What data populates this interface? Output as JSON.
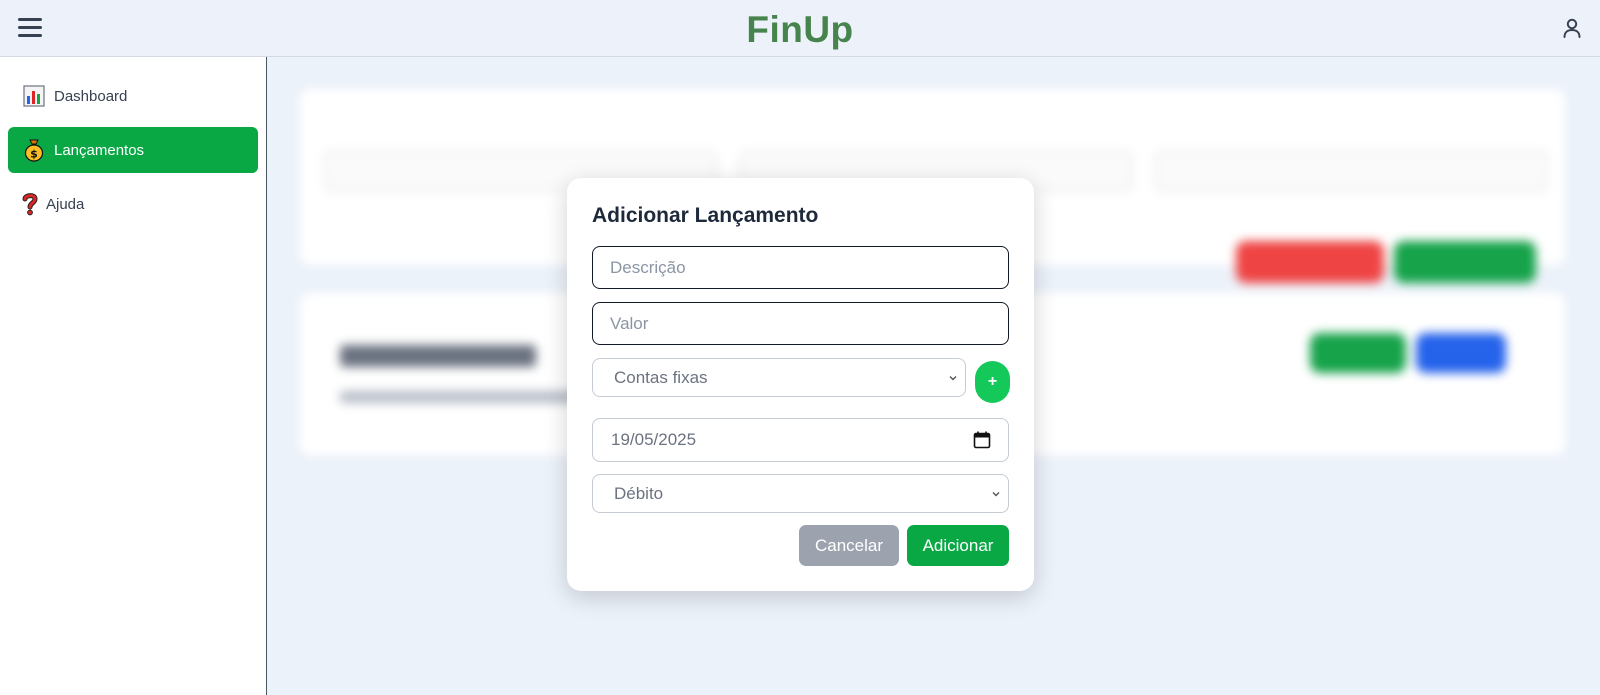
{
  "app": {
    "name": "FinUp",
    "brand_color": "#47834d",
    "accent_color": "#0aa845"
  },
  "header": {
    "menu_icon": "hamburger-icon",
    "user_icon": "user-icon"
  },
  "sidebar": {
    "items": [
      {
        "label": "Dashboard",
        "icon": "bar-chart-icon",
        "active": false
      },
      {
        "label": "Lançamentos",
        "icon": "money-bag-icon",
        "active": true
      },
      {
        "label": "Ajuda",
        "icon": "question-mark-icon",
        "active": false
      }
    ]
  },
  "modal": {
    "title": "Adicionar Lançamento",
    "description_placeholder": "Descrição",
    "value_placeholder": "Valor",
    "category_selected": "Contas fixas",
    "add_category_label": "+",
    "date_value": "19/05/2025",
    "type_selected": "Débito",
    "cancel_label": "Cancelar",
    "submit_label": "Adicionar"
  }
}
